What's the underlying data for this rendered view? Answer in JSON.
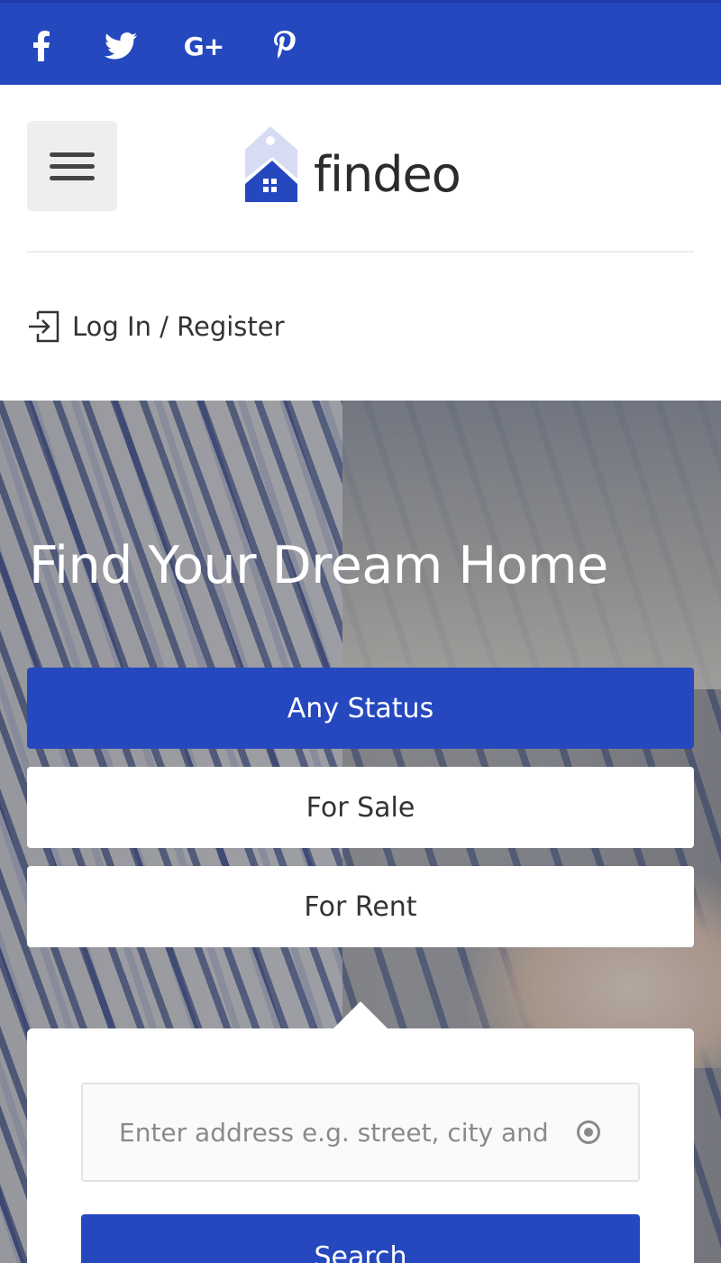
{
  "social": {
    "facebook_icon": "facebook-icon",
    "twitter_icon": "twitter-icon",
    "googleplus_label": "G+",
    "pinterest_icon": "pinterest-icon"
  },
  "header": {
    "menu_icon": "hamburger-menu-icon",
    "logo_text": "findeo",
    "login_label": "Log In / Register",
    "login_icon": "sign-in-icon"
  },
  "hero": {
    "title": "Find Your Dream Home",
    "status_options": [
      "Any Status",
      "For Sale",
      "For Rent"
    ],
    "selected_status": "Any Status"
  },
  "search": {
    "address_placeholder": "Enter address e.g. street, city and state or zip",
    "location_icon": "target-location-icon",
    "button_label": "Search"
  },
  "colors": {
    "brand": "#2548bf",
    "topbar": "#2548bf",
    "text": "#333333"
  }
}
